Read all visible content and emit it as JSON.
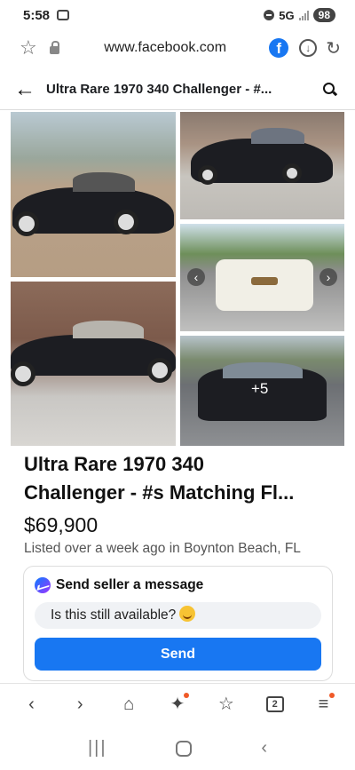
{
  "status_bar": {
    "time": "5:58",
    "network": "5G",
    "battery": "98"
  },
  "browser": {
    "url": "www.facebook.com",
    "fb_letter": "f"
  },
  "header": {
    "title": "Ultra Rare 1970 340 Challenger - #..."
  },
  "gallery": {
    "more_count": "+5"
  },
  "listing": {
    "title_line1": "Ultra Rare 1970 340",
    "title_line2": "Challenger - #s Matching  Fl...",
    "price": "$69,900",
    "meta": "Listed over a week ago in Boynton Beach, FL"
  },
  "message": {
    "heading": "Send seller a message",
    "input_value": "Is this still available?",
    "send_label": "Send"
  },
  "bottom_toolbar": {
    "tabs_count": "2"
  },
  "icons": {
    "back": "arrow-left-icon",
    "search": "search-icon",
    "bookmark": "star-icon",
    "lock": "lock-icon",
    "download": "download-icon",
    "reload": "reload-icon",
    "messenger": "messenger-icon",
    "emoji": "smile-emoji-icon"
  },
  "colors": {
    "facebook_blue": "#1877f2",
    "badge_orange": "#f05a28",
    "text_dark": "#1c1e21",
    "text_muted": "#555555"
  }
}
